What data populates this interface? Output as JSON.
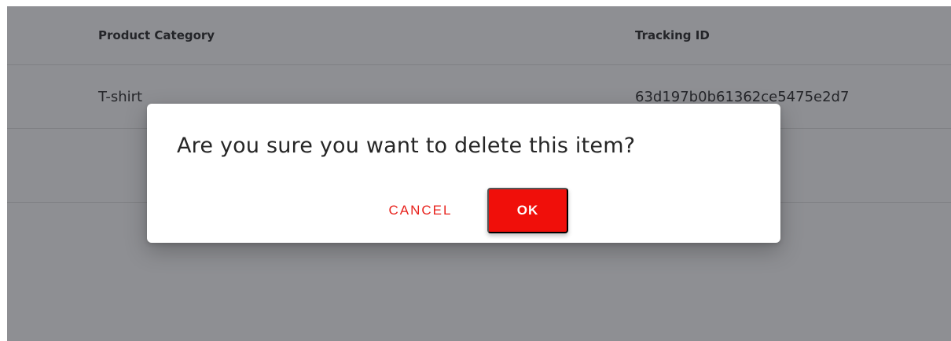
{
  "table": {
    "columns": [
      "Product Category",
      "Tracking ID"
    ],
    "rows": [
      [
        "T-shirt",
        "63d197b0b61362ce5475e2d7"
      ]
    ]
  },
  "dialog": {
    "message": "Are you sure you want to delete this item?",
    "cancel_label": "CANCEL",
    "ok_label": "OK"
  },
  "colors": {
    "accent": "#f00f0a",
    "cancel_text": "#e8221c"
  }
}
